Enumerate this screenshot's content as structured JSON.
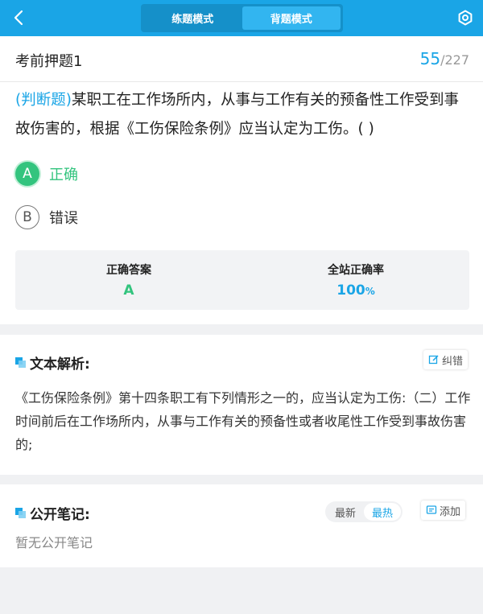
{
  "header": {
    "modes": [
      "练题模式",
      "背题模式"
    ],
    "active_mode": 1,
    "accent": "#1aa5e6"
  },
  "exam": {
    "title": "考前押题1",
    "current": "55",
    "total": "/227"
  },
  "question": {
    "type_label": "(判断题)",
    "text": "某职工在工作场所内，从事与工作有关的预备性工作受到事故伤害的，根据《工伤保险条例》应当认定为工伤。(      )"
  },
  "options": [
    {
      "letter": "A",
      "text": "正确",
      "state": "correct"
    },
    {
      "letter": "B",
      "text": "错误",
      "state": "normal"
    }
  ],
  "stats": {
    "answer_label": "正确答案",
    "answer_value": "A",
    "rate_label": "全站正确率",
    "rate_value": "100",
    "rate_unit": "%"
  },
  "analysis": {
    "title": "文本解析:",
    "correct_btn": "纠错",
    "text": "《工伤保险条例》第十四条职工有下列情形之一的，应当认定为工伤:（二）工作时间前后在工作场所内，从事与工作有关的预备性或者收尾性工作受到事故伤害的;"
  },
  "notes": {
    "title": "公开笔记:",
    "sort_tabs": [
      "最新",
      "最热"
    ],
    "active_sort": 1,
    "add_btn": "添加",
    "empty_text": "暂无公开笔记"
  },
  "colors": {
    "correct_green": "#33c47e",
    "topbar_blue": "#1aa5e6"
  },
  "icons": {
    "back": "chevron-left-icon",
    "settings": "gear-icon",
    "edit": "edit-icon",
    "note": "note-icon"
  }
}
